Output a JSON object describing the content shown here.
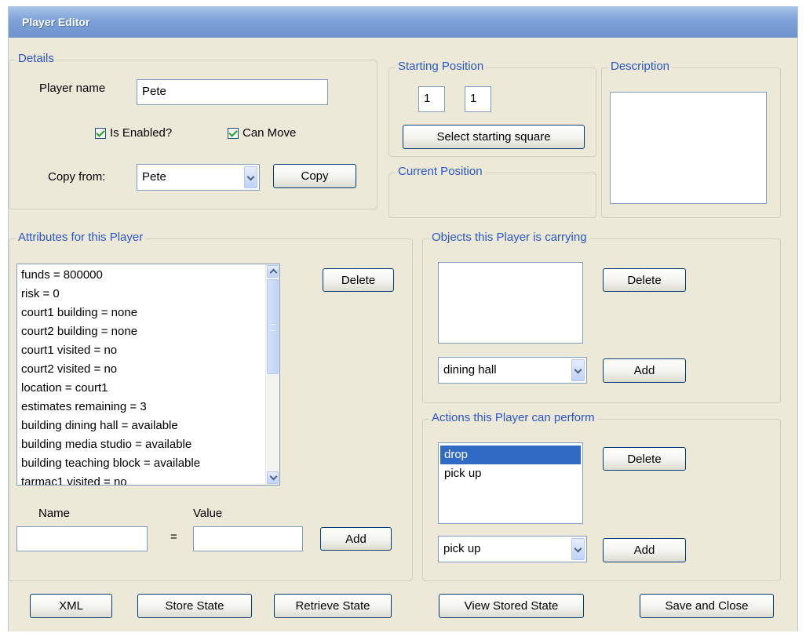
{
  "window": {
    "title": "Player Editor"
  },
  "details": {
    "legend": "Details",
    "player_name_label": "Player name",
    "player_name_value": "Pete",
    "is_enabled_label": "Is Enabled?",
    "is_enabled_checked": true,
    "can_move_label": "Can Move",
    "can_move_checked": true,
    "copy_from_label": "Copy from:",
    "copy_from_value": "Pete",
    "copy_button": "Copy"
  },
  "starting_position": {
    "legend": "Starting Position",
    "x": "1",
    "y": "1",
    "select_button": "Select starting square"
  },
  "current_position": {
    "legend": "Current Position"
  },
  "description": {
    "legend": "Description",
    "value": ""
  },
  "attributes": {
    "legend": "Attributes for this Player",
    "items": [
      "funds = 800000",
      "risk = 0",
      "court1 building = none",
      "court2 building = none",
      "court1 visited = no",
      "court2 visited = no",
      "location = court1",
      "estimates remaining = 3",
      "building dining hall = available",
      "building media studio = available",
      "building teaching block = available",
      "tarmac1 visited = no"
    ],
    "delete_button": "Delete",
    "name_label": "Name",
    "value_label": "Value",
    "equals": "=",
    "name_value": "",
    "value_value": "",
    "add_button": "Add"
  },
  "objects": {
    "legend": "Objects this Player is carrying",
    "items": [],
    "delete_button": "Delete",
    "combo_value": "dining hall",
    "add_button": "Add"
  },
  "actions": {
    "legend": "Actions this Player can perform",
    "items": [
      "drop",
      "pick up"
    ],
    "selected_index": 0,
    "delete_button": "Delete",
    "combo_value": "pick up",
    "add_button": "Add"
  },
  "footer": {
    "xml_button": "XML",
    "store_state_button": "Store State",
    "retrieve_state_button": "Retrieve State",
    "view_stored_state_button": "View Stored State",
    "save_close_button": "Save and Close"
  },
  "icons": {
    "checkbox": "checkmark-icon",
    "dropdown": "chevron-down-icon",
    "scroll_up": "scroll-up-arrow-icon",
    "scroll_down": "scroll-down-arrow-icon"
  },
  "colors": {
    "title_bar": "#7ea1d8",
    "group_legend": "#2a56c6",
    "window_bg": "#ece9d8",
    "selection": "#316ac5"
  }
}
